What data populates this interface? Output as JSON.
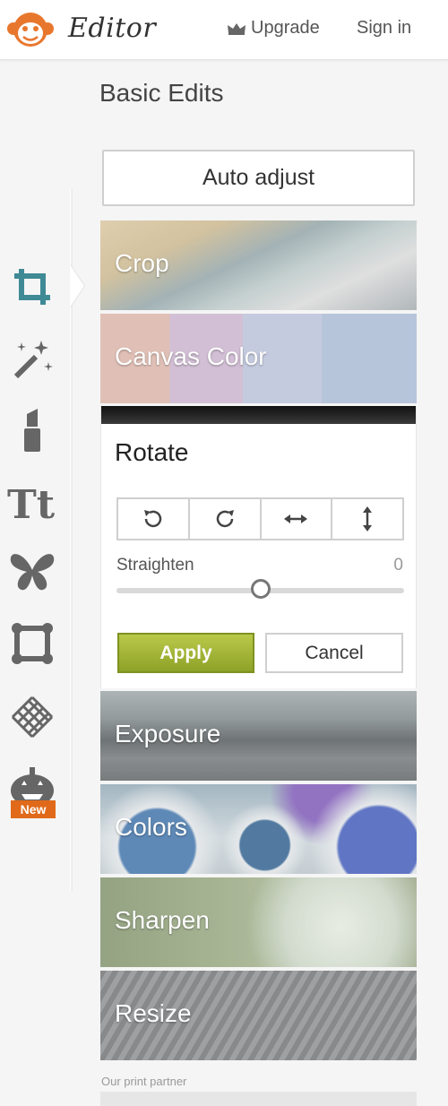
{
  "header": {
    "brand": "Editor",
    "upgrade_label": "Upgrade",
    "signin_label": "Sign in"
  },
  "rail": {
    "tools": [
      {
        "name": "crop-tool-icon",
        "active": true
      },
      {
        "name": "effects-wand-icon"
      },
      {
        "name": "touch-up-lipstick-icon"
      },
      {
        "name": "text-tool-icon"
      },
      {
        "name": "overlay-butterfly-icon"
      },
      {
        "name": "frame-tool-icon"
      },
      {
        "name": "texture-tool-icon"
      },
      {
        "name": "pumpkin-theme-icon"
      }
    ],
    "new_badge": "New"
  },
  "panel": {
    "title": "Basic Edits",
    "auto_adjust": "Auto adjust",
    "cards": {
      "crop": "Crop",
      "canvas_color": "Canvas Color",
      "exposure": "Exposure",
      "colors": "Colors",
      "sharpen": "Sharpen",
      "resize": "Resize"
    },
    "rotate": {
      "title": "Rotate",
      "straighten_label": "Straighten",
      "straighten_value": "0",
      "straighten_fraction": 0.5,
      "apply_label": "Apply",
      "cancel_label": "Cancel"
    },
    "partner_label": "Our print partner"
  },
  "colors": {
    "accent": "#3f8a95",
    "apply_green": "#9fb235",
    "badge_orange": "#e06a1a",
    "logo_orange": "#e8772e"
  }
}
